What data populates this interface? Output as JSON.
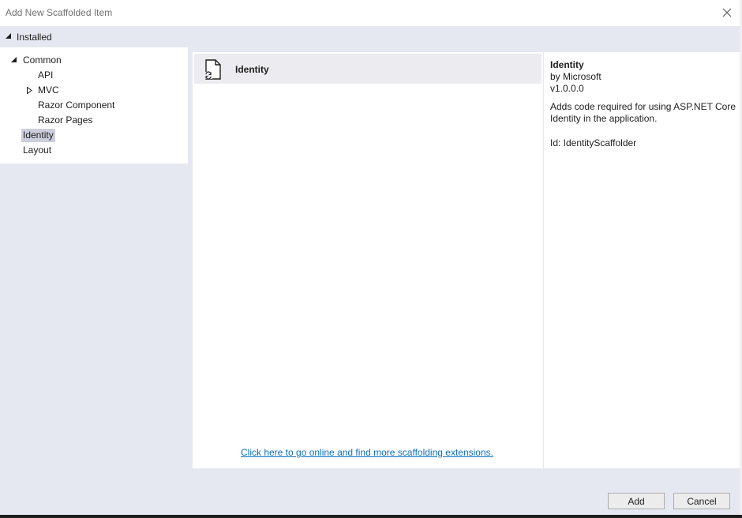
{
  "window": {
    "title": "Add New Scaffolded Item"
  },
  "installed": {
    "label": "Installed"
  },
  "tree": {
    "items": [
      {
        "label": "Common"
      },
      {
        "label": "API"
      },
      {
        "label": "MVC"
      },
      {
        "label": "Razor Component"
      },
      {
        "label": "Razor Pages"
      },
      {
        "label": "Identity"
      },
      {
        "label": "Layout"
      }
    ],
    "selected": "Identity"
  },
  "templates": [
    {
      "name": "Identity",
      "icon": "scaffold-file-icon"
    }
  ],
  "online_link": "Click here to go online and find more scaffolding extensions.",
  "details": {
    "name": "Identity",
    "by": "by Microsoft",
    "version": "v1.0.0.0",
    "description": "Adds code required for using ASP.NET Core Identity in the application.",
    "id": "Id: IdentityScaffolder"
  },
  "buttons": {
    "add": "Add",
    "cancel": "Cancel"
  },
  "colors": {
    "panel_bg": "#e6e8f1",
    "selection": "#cccedb",
    "link": "#0e70c0"
  }
}
